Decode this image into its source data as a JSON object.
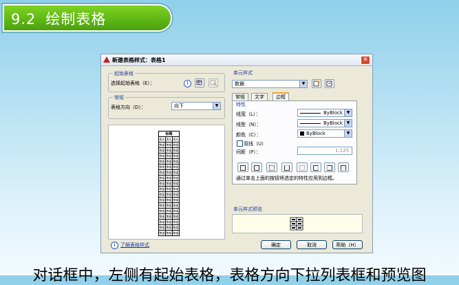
{
  "slide": {
    "number": "9.2",
    "title": "绘制表格",
    "caption": "对话框中，左侧有起始表格，表格方向下拉列表框和预览图"
  },
  "dialog": {
    "title": "新建表格样式：表格1",
    "close": "✕",
    "start_table": {
      "group_label": "起始表格",
      "select_label": "选择起始表格（E）："
    },
    "general": {
      "group_label": "常规",
      "direction_label": "表格方向（D）：",
      "direction_value": "向下"
    },
    "preview_table": {
      "title": "标题",
      "header_row": [
        "表头",
        "表头",
        "表头"
      ],
      "data_cell": "数据",
      "data_rows": 17
    },
    "cell_style": {
      "group_label": "单元样式",
      "selected": "数据",
      "tabs": [
        "常规",
        "文字",
        "边框"
      ],
      "active_tab": "边框",
      "properties_label": "特性",
      "linewidth_label": "线宽（L）：",
      "linewidth_value": "ByBlock",
      "linetype_label": "线型（N）：",
      "linetype_value": "ByBlock",
      "color_label": "颜色（C）：",
      "color_value": "ByBlock",
      "double_line_label": "双线（U）",
      "spacing_label": "间距（P）：",
      "spacing_value": "1.125",
      "hint": "通过单击上面的按钮将选定的特性应用到边框。"
    },
    "cell_preview": {
      "group_label": "单元样式预览"
    },
    "footer": {
      "help_link": "了解表格样式",
      "ok": "确定",
      "cancel": "取消",
      "help": "帮助（H）"
    }
  },
  "colors": {
    "slide_title_green": "#4aa10f",
    "active_tab_orange": "#f2a22c",
    "group_label_blue": "#1c3fa0"
  }
}
